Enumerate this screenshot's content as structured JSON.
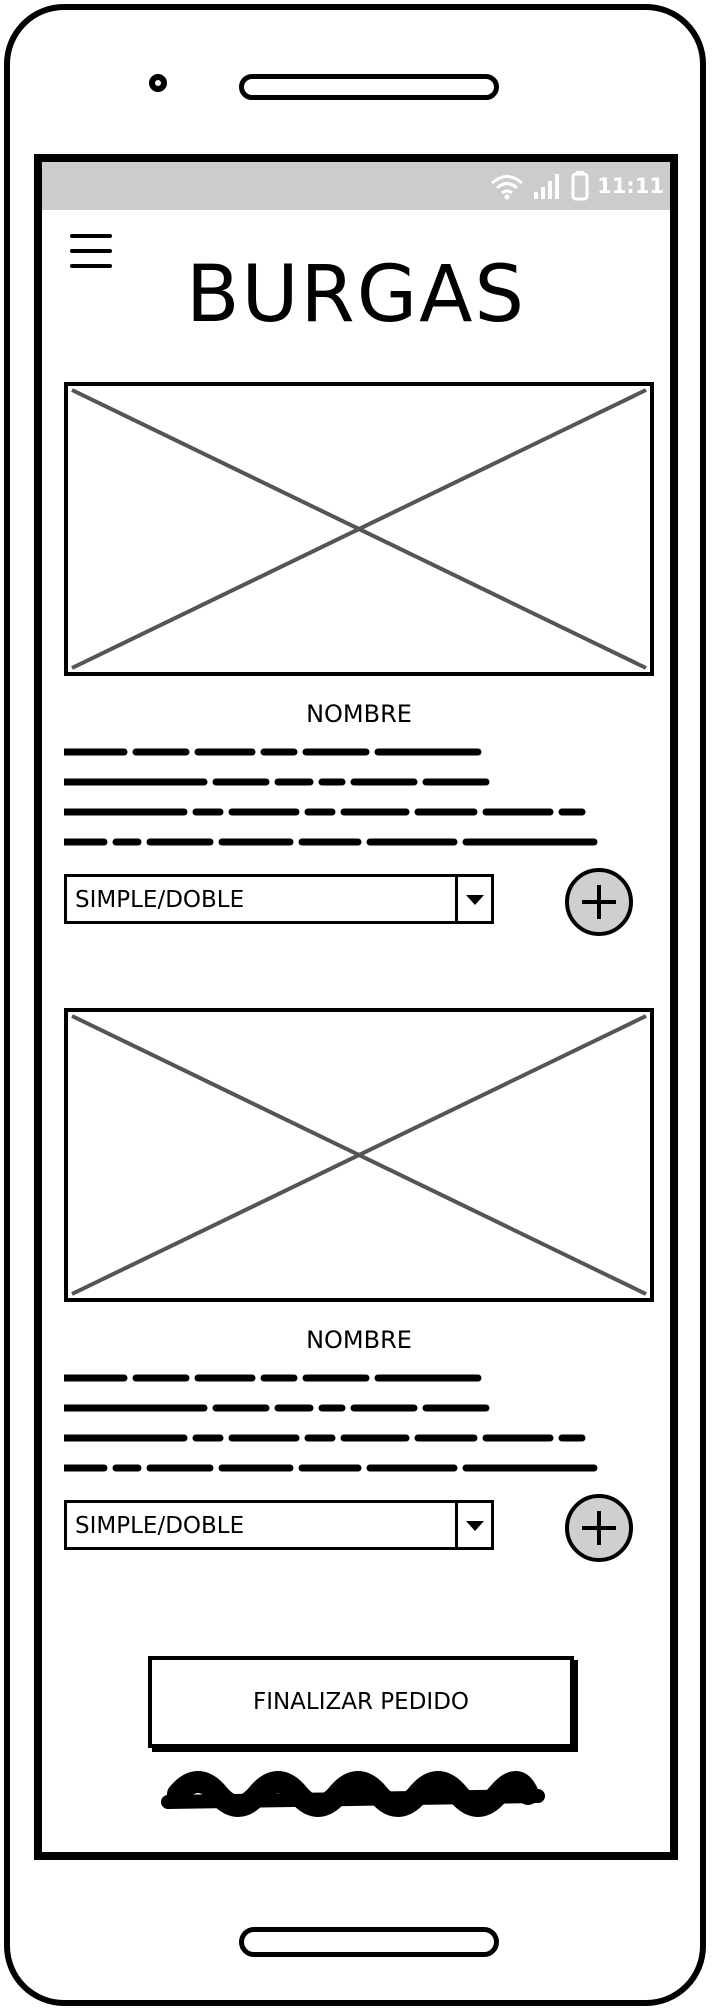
{
  "app": {
    "title": "BURGAS"
  },
  "statusbar": {
    "time": "11:11",
    "icons": [
      "wifi-icon",
      "signal-icon",
      "battery-icon"
    ]
  },
  "header": {
    "menu_icon": "hamburger-menu-icon"
  },
  "products": [
    {
      "name": "NOMBRE",
      "image": "image-placeholder",
      "variant_select": {
        "value": "SIMPLE/DOBLE"
      },
      "add_icon": "plus-circle-icon"
    },
    {
      "name": "NOMBRE",
      "image": "image-placeholder",
      "variant_select": {
        "value": "SIMPLE/DOBLE"
      },
      "add_icon": "plus-circle-icon"
    }
  ],
  "footer": {
    "finish_label": "FINALIZAR PEDIDO"
  },
  "colors": {
    "statusbar_bg": "#cccccc",
    "add_button_fill": "#cfcfcf",
    "placeholder_stroke": "#555555"
  }
}
